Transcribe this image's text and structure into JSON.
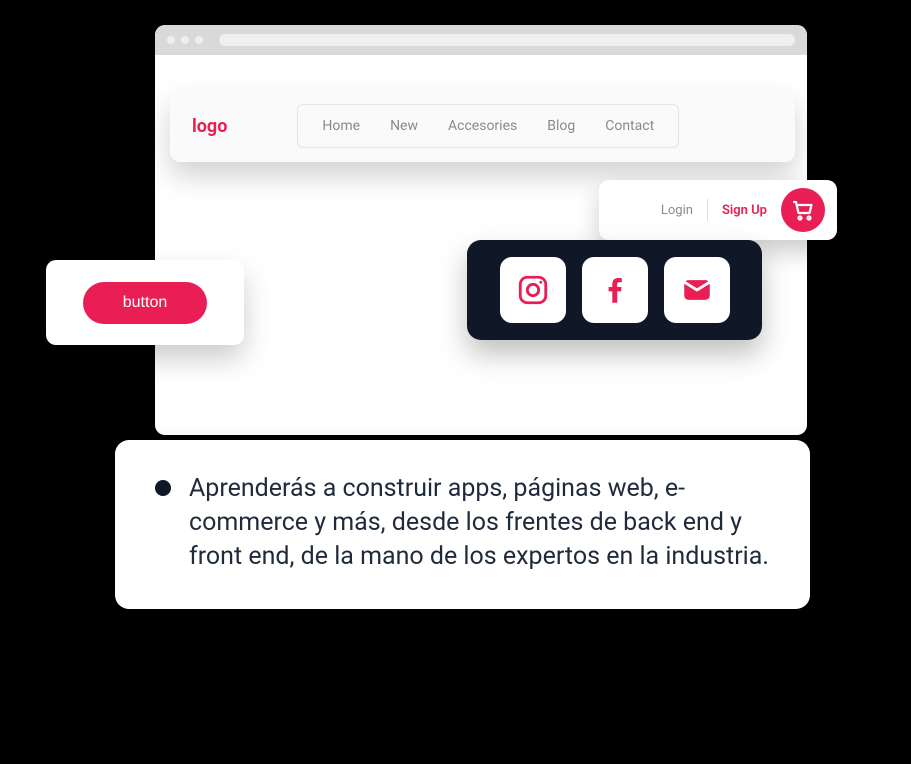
{
  "header": {
    "logo": "logo",
    "nav": [
      "Home",
      "New",
      "Accesories",
      "Blog",
      "Contact"
    ]
  },
  "auth": {
    "login": "Login",
    "signup": "Sign Up"
  },
  "button": {
    "label": "button"
  },
  "social": {
    "items": [
      "instagram",
      "facebook",
      "mail"
    ]
  },
  "info": {
    "text": "Aprenderás a construir apps, páginas web, e-commerce y más, desde los frentes de back end y front end, de la mano de los expertos en la industria."
  },
  "colors": {
    "accent": "#e91e55",
    "dark": "#101827"
  }
}
